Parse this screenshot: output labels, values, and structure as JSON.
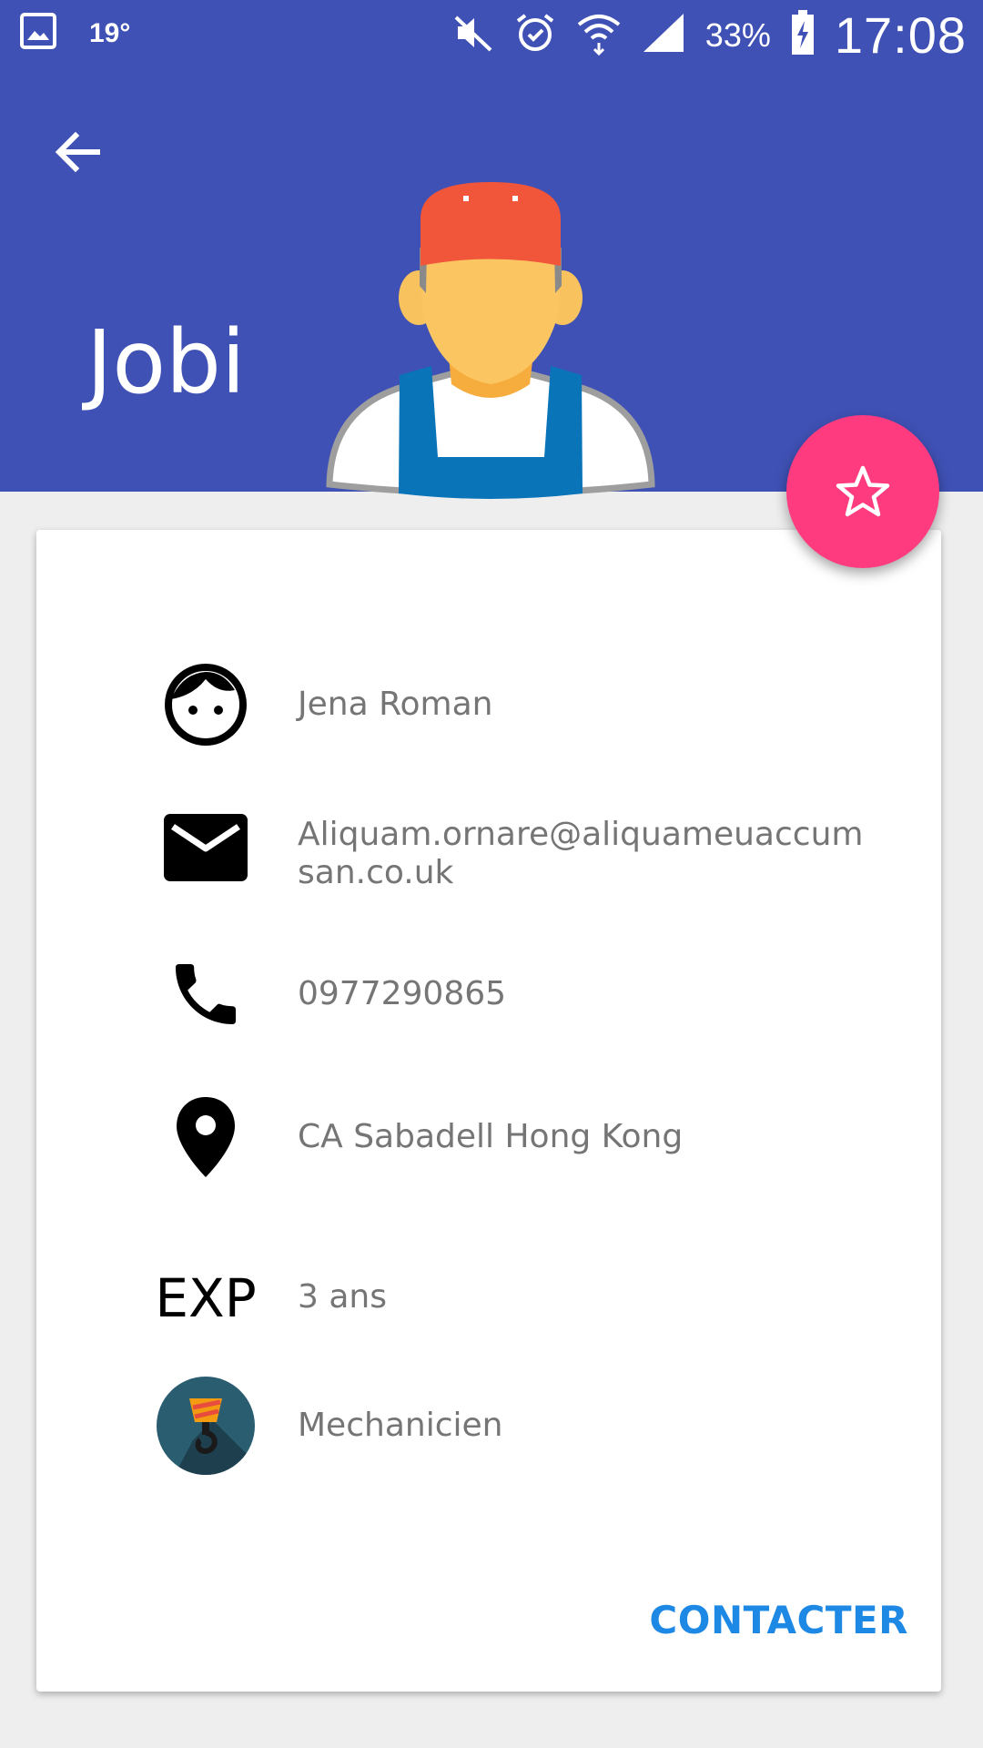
{
  "status_bar": {
    "temperature": "19°",
    "battery": "33%",
    "time": "17:08",
    "icons": [
      "gallery-icon",
      "mute-icon",
      "alarm-icon",
      "wifi-icon",
      "signal-icon",
      "battery-charging-icon"
    ]
  },
  "header": {
    "title": "Jobi",
    "back_icon": "arrow-left-icon",
    "illustration": "worker-avatar"
  },
  "fab": {
    "icon": "star-outline-icon"
  },
  "colors": {
    "primary": "#3f51b5",
    "accent": "#ff3b80",
    "link": "#1e88e5",
    "text_secondary": "#757575"
  },
  "details": {
    "name": "Jena Roman",
    "email": "Aliquam.ornare@aliquameuaccumsan.co.uk",
    "phone": "0977290865",
    "location": "CA Sabadell Hong Kong",
    "experience_label": "EXP",
    "experience": "3 ans",
    "profession": "Mechanicien"
  },
  "actions": {
    "contact_label": "CONTACTER"
  }
}
